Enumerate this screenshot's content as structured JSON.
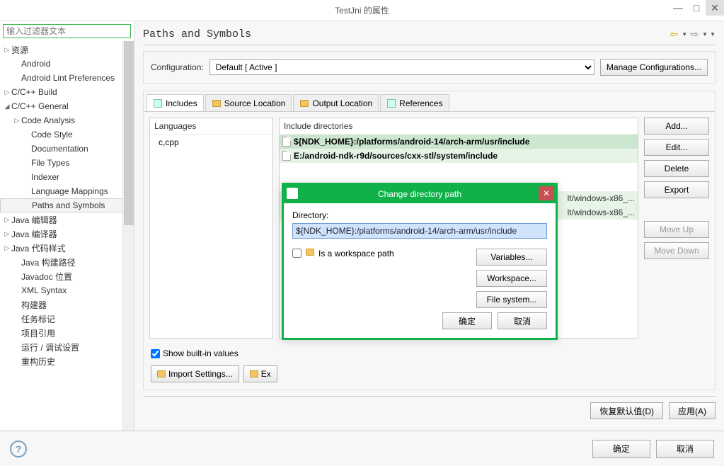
{
  "window": {
    "title": "TestJni 的属性"
  },
  "filter": {
    "placeholder": "输入过滤器文本"
  },
  "tree": [
    {
      "label": "资源",
      "depth": 0,
      "arrow": "▷"
    },
    {
      "label": "Android",
      "depth": 1,
      "arrow": ""
    },
    {
      "label": "Android Lint Preferences",
      "depth": 1,
      "arrow": ""
    },
    {
      "label": "C/C++ Build",
      "depth": 0,
      "arrow": "▷"
    },
    {
      "label": "C/C++ General",
      "depth": 0,
      "arrow": "◢"
    },
    {
      "label": "Code Analysis",
      "depth": 1,
      "arrow": "▷"
    },
    {
      "label": "Code Style",
      "depth": 2,
      "arrow": ""
    },
    {
      "label": "Documentation",
      "depth": 2,
      "arrow": ""
    },
    {
      "label": "File Types",
      "depth": 2,
      "arrow": ""
    },
    {
      "label": "Indexer",
      "depth": 2,
      "arrow": ""
    },
    {
      "label": "Language Mappings",
      "depth": 2,
      "arrow": ""
    },
    {
      "label": "Paths and Symbols",
      "depth": 2,
      "arrow": "",
      "selected": true
    },
    {
      "label": "Java 编辑器",
      "depth": 0,
      "arrow": "▷"
    },
    {
      "label": "Java 编译器",
      "depth": 0,
      "arrow": "▷"
    },
    {
      "label": "Java 代码样式",
      "depth": 0,
      "arrow": "▷"
    },
    {
      "label": "Java 构建路径",
      "depth": 1,
      "arrow": ""
    },
    {
      "label": "Javadoc 位置",
      "depth": 1,
      "arrow": ""
    },
    {
      "label": "XML Syntax",
      "depth": 1,
      "arrow": ""
    },
    {
      "label": "构建器",
      "depth": 1,
      "arrow": ""
    },
    {
      "label": "任务标记",
      "depth": 1,
      "arrow": ""
    },
    {
      "label": "项目引用",
      "depth": 1,
      "arrow": ""
    },
    {
      "label": "运行 / 调试设置",
      "depth": 1,
      "arrow": ""
    },
    {
      "label": "重构历史",
      "depth": 1,
      "arrow": ""
    }
  ],
  "page": {
    "title": "Paths and Symbols"
  },
  "config": {
    "label": "Configuration:",
    "value": "Default  [ Active ]",
    "manage": "Manage Configurations..."
  },
  "tabs": {
    "includes": "Includes",
    "source": "Source Location",
    "output": "Output Location",
    "refs": "References"
  },
  "languages": {
    "header": "Languages",
    "item": "c,cpp"
  },
  "includes": {
    "header": "Include directories",
    "rows": [
      "${NDK_HOME}:/platforms/android-14/arch-arm/usr/include",
      "E:/android-ndk-r9d/sources/cxx-stl/system/include",
      "lt/windows-x86_...",
      "lt/windows-x86_..."
    ]
  },
  "sidebtns": {
    "add": "Add...",
    "edit": "Edit...",
    "del": "Delete",
    "export": "Export",
    "up": "Move Up",
    "down": "Move Down"
  },
  "checkbox": "Show built-in values",
  "import": "Import Settings...",
  "exportbtn": "Ex",
  "restore": "恢复默认值(D)",
  "apply": "应用(A)",
  "ok": "确定",
  "cancel": "取消",
  "modal": {
    "title": "Change directory path",
    "label": "Directory:",
    "value": "${NDK_HOME}:/platforms/android-14/arch-arm/usr/include",
    "workspace_chk": "Is a workspace path",
    "variables": "Variables...",
    "workspace": "Workspace...",
    "filesys": "File system...",
    "ok": "确定",
    "cancel": "取消"
  }
}
